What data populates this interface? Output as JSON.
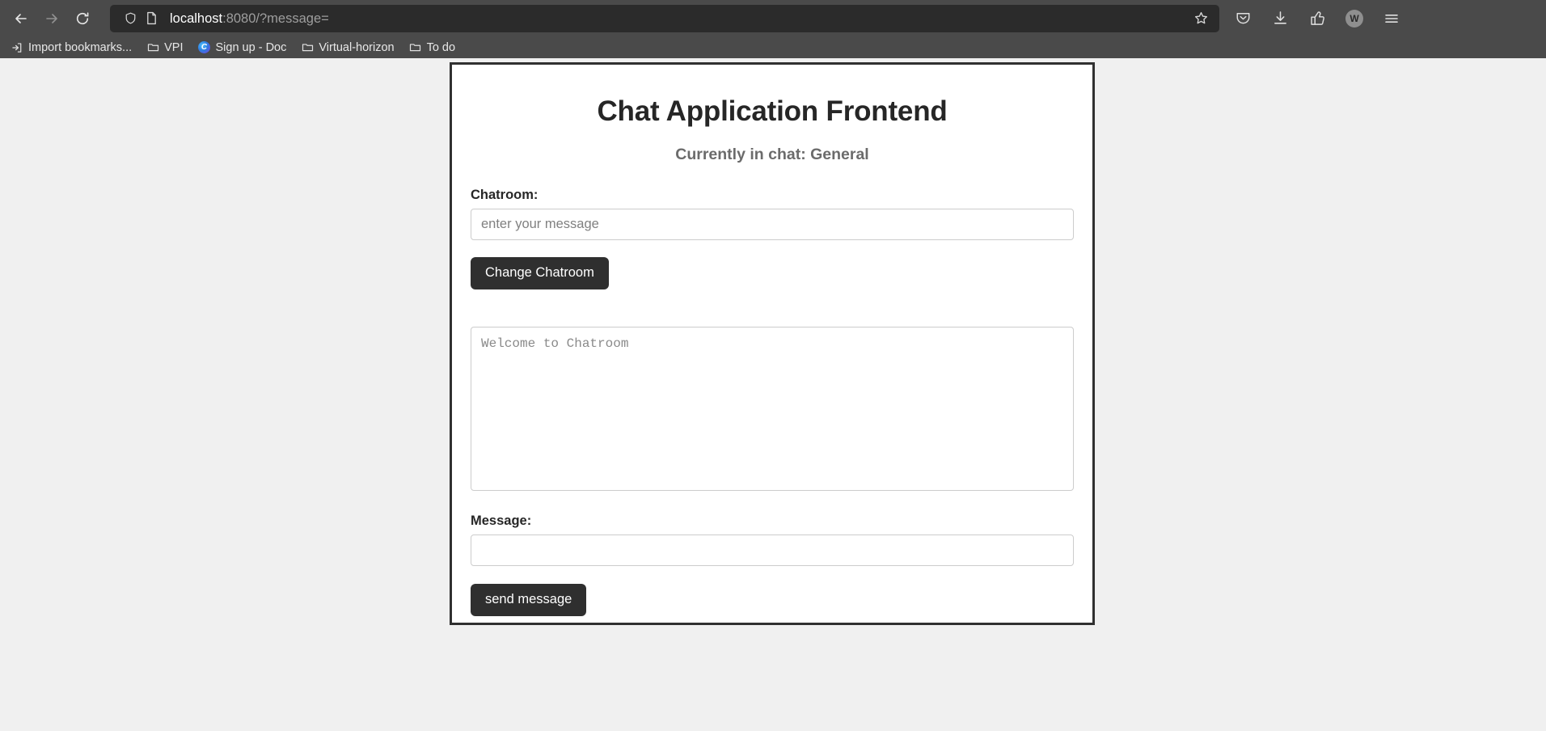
{
  "browser": {
    "nav": {
      "back_label": "Back",
      "forward_label": "Forward",
      "reload_label": "Reload"
    },
    "urlbar": {
      "shield_label": "Tracking protection",
      "page_icon_label": "Page info",
      "host": "localhost",
      "path": ":8080/?message=",
      "bookmark_star_label": "Bookmark this page"
    },
    "toolbar_right": [
      {
        "name": "pocket-icon",
        "label": "Save to Pocket"
      },
      {
        "name": "download-icon",
        "label": "Downloads"
      },
      {
        "name": "extension-icon",
        "label": "Extensions"
      },
      {
        "name": "account-avatar",
        "label": "W"
      },
      {
        "name": "menu-icon",
        "label": "Open application menu"
      }
    ],
    "bookmarks": [
      {
        "label": "Import bookmarks...",
        "icon": "import-icon"
      },
      {
        "label": "VPI",
        "icon": "folder-icon"
      },
      {
        "label": "Sign up - Doc",
        "icon": "site-favicon"
      },
      {
        "label": "Virtual-horizon",
        "icon": "folder-icon"
      },
      {
        "label": "To do",
        "icon": "folder-icon"
      }
    ]
  },
  "page": {
    "title": "Chat Application Frontend",
    "chat_status": "Currently in chat: General",
    "chatroom_label": "Chatroom:",
    "chatroom_input_value": "",
    "chatroom_input_placeholder": "enter your message",
    "change_chatroom_button": "Change Chatroom",
    "chat_log_value": "",
    "chat_log_placeholder": "Welcome to Chatroom",
    "message_label": "Message:",
    "message_input_value": "",
    "message_input_placeholder": "",
    "send_button": "send message"
  },
  "colors": {
    "chrome_bg": "#4a4a4a",
    "urlbar_bg": "#2b2b2b",
    "page_bg": "#f0f0f0",
    "card_border": "#303030",
    "button_bg": "#2f2f2f",
    "muted_text": "#6b6b6b"
  }
}
